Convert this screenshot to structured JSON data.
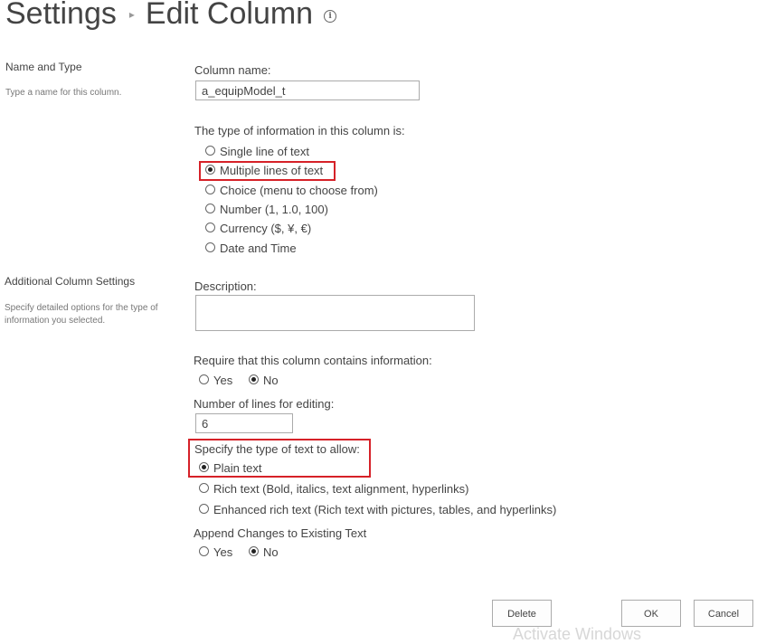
{
  "header": {
    "crumb_settings": "Settings",
    "separator": "▸",
    "crumb_edit": "Edit Column",
    "info_glyph": "i"
  },
  "name_type": {
    "title": "Name and Type",
    "description": "Type a name for this column."
  },
  "column_name": {
    "label": "Column name:",
    "value": "a_equipModel_t"
  },
  "type_info": {
    "label": "The type of information in this column is:",
    "options": [
      "Single line of text",
      "Multiple lines of text",
      "Choice (menu to choose from)",
      "Number (1, 1.0, 100)",
      "Currency ($, ¥, €)",
      "Date and Time"
    ],
    "selected": "Multiple lines of text"
  },
  "additional": {
    "title": "Additional Column Settings",
    "description_line1": "Specify detailed options for the type of",
    "description_line2": "information you selected."
  },
  "description_field": {
    "label": "Description:",
    "value": ""
  },
  "require": {
    "label": "Require that this column contains information:",
    "yes": "Yes",
    "no": "No",
    "selected": "No"
  },
  "lines": {
    "label": "Number of lines for editing:",
    "value": "6"
  },
  "text_type": {
    "label": "Specify the type of text to allow:",
    "options": [
      "Plain text",
      "Rich text (Bold, italics, text alignment, hyperlinks)",
      "Enhanced rich text (Rich text with pictures, tables, and hyperlinks)"
    ],
    "selected": "Plain text"
  },
  "append": {
    "label": "Append Changes to Existing Text",
    "yes": "Yes",
    "no": "No",
    "selected": "No"
  },
  "buttons": {
    "delete": "Delete",
    "ok": "OK",
    "cancel": "Cancel"
  },
  "watermark": "Activate Windows",
  "colors": {
    "highlight": "#d62128",
    "text": "#444444",
    "muted": "#777777"
  }
}
